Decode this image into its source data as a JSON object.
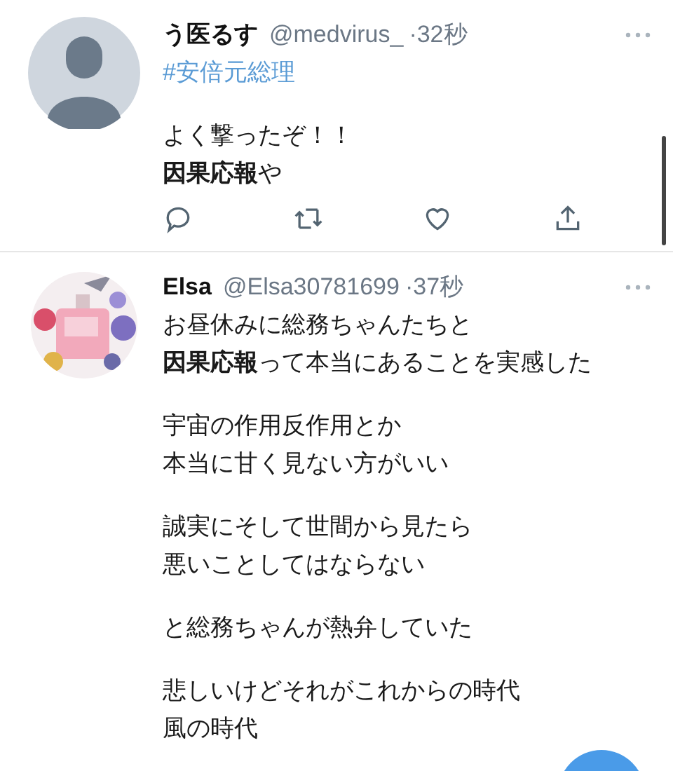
{
  "tweets": [
    {
      "avatar": {
        "kind": "default"
      },
      "name": "う医るす",
      "handle": "@medvirus_",
      "time": "·32秒",
      "paragraphs": [
        [
          {
            "text": "#安倍元総理",
            "kind": "hashtag"
          }
        ],
        [
          {
            "text": "よく撃ったぞ！！",
            "kind": "plain"
          },
          {
            "text": "**因果応報**や",
            "kind": "plain"
          }
        ]
      ],
      "actions": true
    },
    {
      "avatar": {
        "kind": "picture"
      },
      "name": "Elsa",
      "handle": "@Elsa30781699",
      "time": "·37秒",
      "paragraphs": [
        [
          {
            "text": "お昼休みに総務ちゃんたちと",
            "kind": "plain"
          },
          {
            "text": "**因果応報**って本当にあることを実感した",
            "kind": "plain"
          }
        ],
        [
          {
            "text": "宇宙の作用反作用とか",
            "kind": "plain"
          },
          {
            "text": "本当に甘く見ない方がいい",
            "kind": "plain"
          }
        ],
        [
          {
            "text": "誠実にそして世間から見たら",
            "kind": "plain"
          },
          {
            "text": "悪いことしてはならない",
            "kind": "plain"
          }
        ],
        [
          {
            "text": "と総務ちゃんが熱弁していた",
            "kind": "plain"
          }
        ],
        [
          {
            "text": "悲しいけどそれがこれからの時代",
            "kind": "plain"
          },
          {
            "text": "風の時代",
            "kind": "plain"
          }
        ]
      ],
      "actions": false
    }
  ]
}
